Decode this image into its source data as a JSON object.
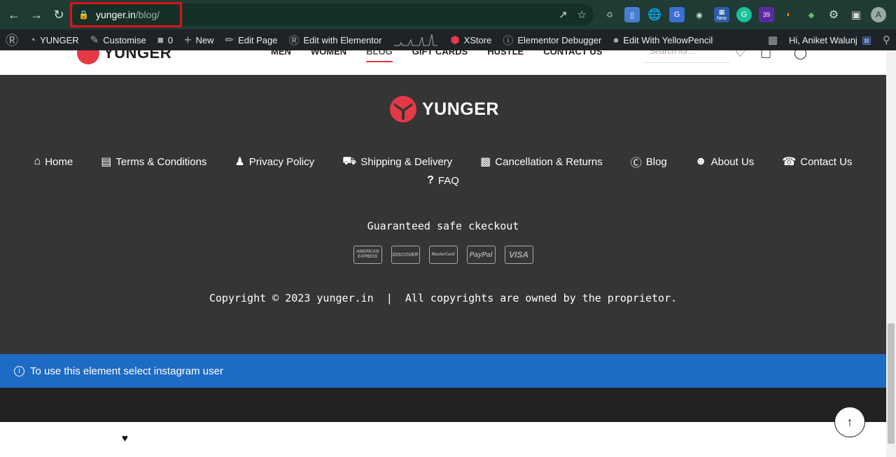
{
  "browser": {
    "url_host": "yunger.in",
    "url_path": "/blog/"
  },
  "adminbar": {
    "site_name": "YUNGER",
    "customise": "Customise",
    "comments_count": "0",
    "new_label": "New",
    "edit_page": "Edit Page",
    "edit_elementor": "Edit with Elementor",
    "xstore": "XStore",
    "debugger": "Elementor Debugger",
    "yellowpencil": "Edit With YellowPencil",
    "greeting": "Hi, Aniket Walunj"
  },
  "extensions": {
    "new_badge": "New",
    "count_badge": "39",
    "avatar_letter": "A"
  },
  "header": {
    "logo_text": "YUNGER",
    "menu": [
      "MEN",
      "WOMEN",
      "BLOG",
      "GIFT CARDS",
      "HUSTLE",
      "CONTACT US"
    ],
    "search_placeholder": "Search for..."
  },
  "footer": {
    "logo_text": "YUNGER",
    "links": [
      {
        "label": "Home",
        "icon": "home-icon"
      },
      {
        "label": "Terms & Conditions",
        "icon": "clipboard-icon"
      },
      {
        "label": "Privacy Policy",
        "icon": "user-lock-icon"
      },
      {
        "label": "Shipping & Delivery",
        "icon": "truck-icon"
      },
      {
        "label": "Cancellation & Returns",
        "icon": "gift-icon"
      },
      {
        "label": "Blog",
        "icon": "blog-icon"
      },
      {
        "label": "About Us",
        "icon": "users-icon"
      },
      {
        "label": "Contact Us",
        "icon": "headset-icon"
      }
    ],
    "faq": "FAQ",
    "safe_checkout": "Guaranteed safe ckeckout",
    "cards": [
      "AMERICAN EXPRESS",
      "DISCOVER",
      "MasterCard",
      "PayPal",
      "VISA"
    ],
    "copyright": "Copyright © 2023 yunger.in  |  All copyrights are owned by the proprietor."
  },
  "notice": {
    "text": "To use this element select instagram user"
  },
  "colors": {
    "brand_red": "#e63946",
    "footer_bg": "#353535",
    "notice_blue": "#1e6bc6",
    "chrome_green": "#1f3b33"
  }
}
